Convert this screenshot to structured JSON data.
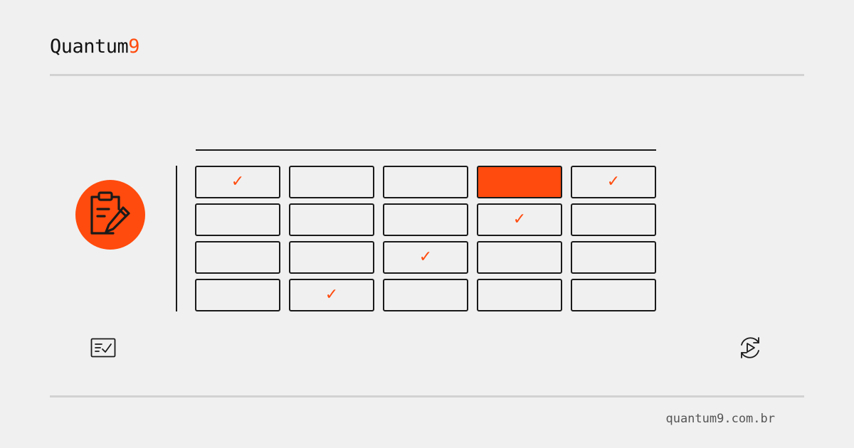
{
  "brand": {
    "name": "Quantum",
    "name_accent": "9"
  },
  "footer": {
    "url": "quantum9.com.br"
  },
  "colors": {
    "accent": "#ff4b0d",
    "background": "#f0f0f0",
    "ink": "#1a1a1a",
    "rule": "#d2d2d2"
  },
  "icons": {
    "badge": "clipboard-edit-icon",
    "bottom_left": "checklist-icon",
    "bottom_right": "replay-icon"
  },
  "grid": {
    "rows": [
      [
        {
          "state": "checked"
        },
        {
          "state": "empty"
        },
        {
          "state": "empty"
        },
        {
          "state": "filled"
        },
        {
          "state": "checked"
        }
      ],
      [
        {
          "state": "empty"
        },
        {
          "state": "empty"
        },
        {
          "state": "empty"
        },
        {
          "state": "checked"
        },
        {
          "state": "empty"
        }
      ],
      [
        {
          "state": "empty"
        },
        {
          "state": "empty"
        },
        {
          "state": "checked"
        },
        {
          "state": "empty"
        },
        {
          "state": "empty"
        }
      ],
      [
        {
          "state": "empty"
        },
        {
          "state": "checked"
        },
        {
          "state": "empty"
        },
        {
          "state": "empty"
        },
        {
          "state": "empty"
        }
      ]
    ],
    "check_glyph": "✓"
  }
}
